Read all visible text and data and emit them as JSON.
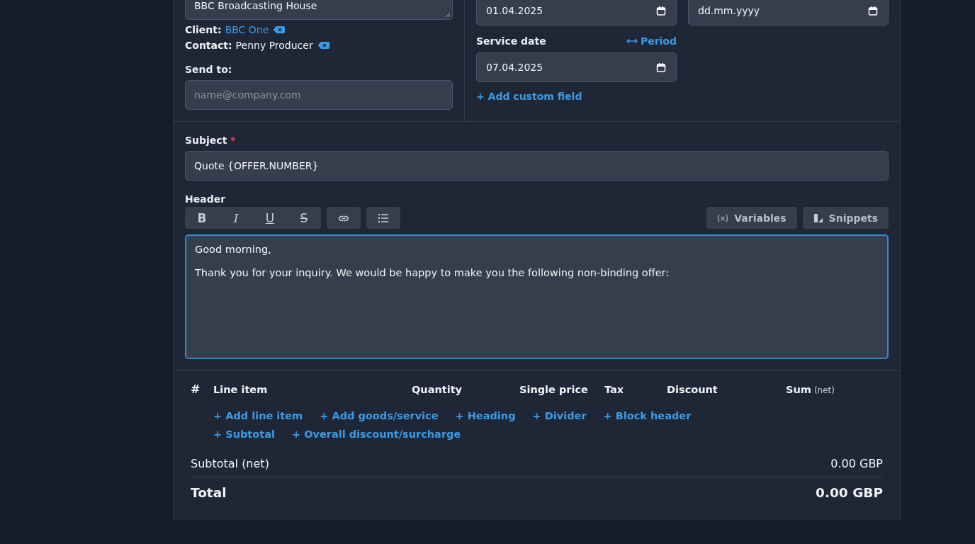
{
  "address": {
    "value": "BBC Broadcasting House"
  },
  "client": {
    "label": "Client:",
    "value": "BBC One"
  },
  "contact": {
    "label": "Contact:",
    "value": "Penny Producer"
  },
  "send_to": {
    "label": "Send to:",
    "placeholder": "name@company.com"
  },
  "dates": [
    {
      "value": "01.04.2025"
    },
    {
      "placeholder": "dd.mm.yyyy"
    }
  ],
  "service_date": {
    "label": "Service date",
    "period_link": "Period",
    "value": "07.04.2025"
  },
  "add_custom_field": "+ Add custom field",
  "subject": {
    "label": "Subject",
    "required_marker": "*",
    "value": "Quote {OFFER.NUMBER}"
  },
  "header": {
    "label": "Header",
    "focused": true,
    "toolbar_groups": [
      {
        "tools": [
          {
            "kind": "bold",
            "glyph": "B"
          },
          {
            "kind": "italic",
            "glyph": "I"
          },
          {
            "kind": "underline",
            "glyph": "U"
          },
          {
            "kind": "strike",
            "glyph": "S"
          }
        ]
      },
      {
        "tools": [
          {
            "kind": "link"
          }
        ]
      },
      {
        "tools": [
          {
            "kind": "list"
          }
        ]
      }
    ],
    "buttons": [
      {
        "kind": "variables",
        "label": "Variables"
      },
      {
        "kind": "snippets",
        "label": "Snippets"
      }
    ],
    "paragraphs": [
      "Good morning,",
      "Thank you for your inquiry. We would be happy to make you the following non-binding offer:"
    ]
  },
  "line_items": {
    "columns": [
      {
        "label": "#"
      },
      {
        "label": "Line item"
      },
      {
        "label": "Quantity"
      },
      {
        "label": "Single price"
      },
      {
        "label": "Tax"
      },
      {
        "label": "Discount"
      },
      {
        "label": "Sum",
        "note": "(net)"
      }
    ],
    "add_links": [
      "+ Add line item",
      "+ Add goods/service",
      "+ Heading",
      "+ Divider",
      "+ Block header",
      "+ Subtotal",
      "+ Overall discount/surcharge"
    ]
  },
  "totals": [
    {
      "kind": "subtotal",
      "label": "Subtotal (net)",
      "value": "0.00 GBP"
    },
    {
      "kind": "total",
      "label": "Total",
      "value": "0.00 GBP"
    }
  ]
}
